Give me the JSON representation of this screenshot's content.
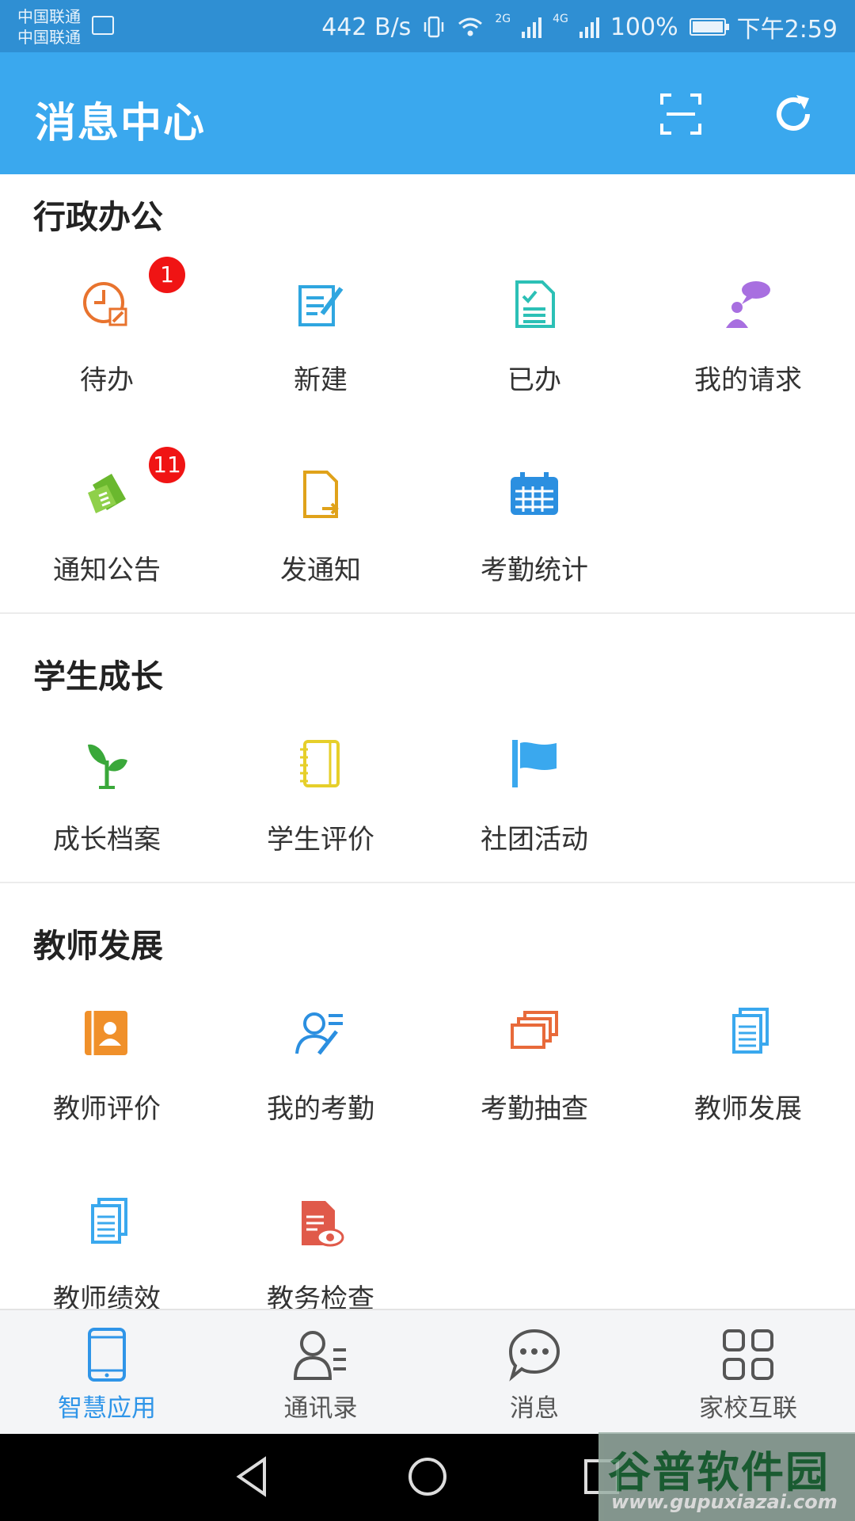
{
  "status_bar": {
    "carrier_1": "中国联通",
    "carrier_2": "中国联通",
    "speed": "442 B/s",
    "net_1": "2G",
    "net_2": "4G",
    "battery": "100%",
    "time": "下午2:59"
  },
  "app_bar": {
    "title": "消息中心",
    "scan_icon": "scan-icon",
    "refresh_icon": "refresh-icon"
  },
  "sections": [
    {
      "title": "行政办公",
      "items": [
        {
          "label": "待办",
          "icon": "todo-clock-icon",
          "color": "#e8732e",
          "badge": "1"
        },
        {
          "label": "新建",
          "icon": "new-edit-icon",
          "color": "#2fa6e0"
        },
        {
          "label": "已办",
          "icon": "done-document-icon",
          "color": "#2cc0b6"
        },
        {
          "label": "我的请求",
          "icon": "my-request-icon",
          "color": "#a86fe0"
        },
        {
          "label": "通知公告",
          "icon": "announcement-scroll-icon",
          "color": "#6ab82e",
          "badge": "11"
        },
        {
          "label": "发通知",
          "icon": "send-notice-icon",
          "color": "#e0a21a"
        },
        {
          "label": "考勤统计",
          "icon": "attendance-calendar-icon",
          "color": "#2b8fe0"
        }
      ]
    },
    {
      "title": "学生成长",
      "items": [
        {
          "label": "成长档案",
          "icon": "growth-sprout-icon",
          "color": "#3aa83a"
        },
        {
          "label": "学生评价",
          "icon": "student-notebook-icon",
          "color": "#e6cf2a"
        },
        {
          "label": "社团活动",
          "icon": "club-flag-icon",
          "color": "#3aa8ee"
        }
      ]
    },
    {
      "title": "教师发展",
      "items": [
        {
          "label": "教师评价",
          "icon": "teacher-contact-book-icon",
          "color": "#f0902a"
        },
        {
          "label": "我的考勤",
          "icon": "my-attendance-user-icon",
          "color": "#2b8fe0"
        },
        {
          "label": "考勤抽查",
          "icon": "attendance-check-cards-icon",
          "color": "#e86a3a"
        },
        {
          "label": "教师发展",
          "icon": "teacher-development-docs-icon",
          "color": "#3aa8ee"
        },
        {
          "label": "教师绩效",
          "icon": "teacher-performance-docs-icon",
          "color": "#3aa8ee"
        },
        {
          "label": "教务检查",
          "icon": "academic-inspection-icon",
          "color": "#e05a4a"
        }
      ]
    }
  ],
  "tab_bar": [
    {
      "label": "智慧应用",
      "icon": "tablet-icon",
      "active": true
    },
    {
      "label": "通讯录",
      "icon": "contacts-icon",
      "active": false
    },
    {
      "label": "消息",
      "icon": "chat-bubble-icon",
      "active": false
    },
    {
      "label": "家校互联",
      "icon": "grid-icon",
      "active": false
    }
  ],
  "watermark": {
    "brand": "谷普软件园",
    "url": "www.gupuxiazai.com"
  },
  "colors": {
    "app_bar": "#3aa8ee",
    "status_bar": "#2f8fd3",
    "tab_active": "#2f95e8",
    "badge": "#f01414"
  }
}
